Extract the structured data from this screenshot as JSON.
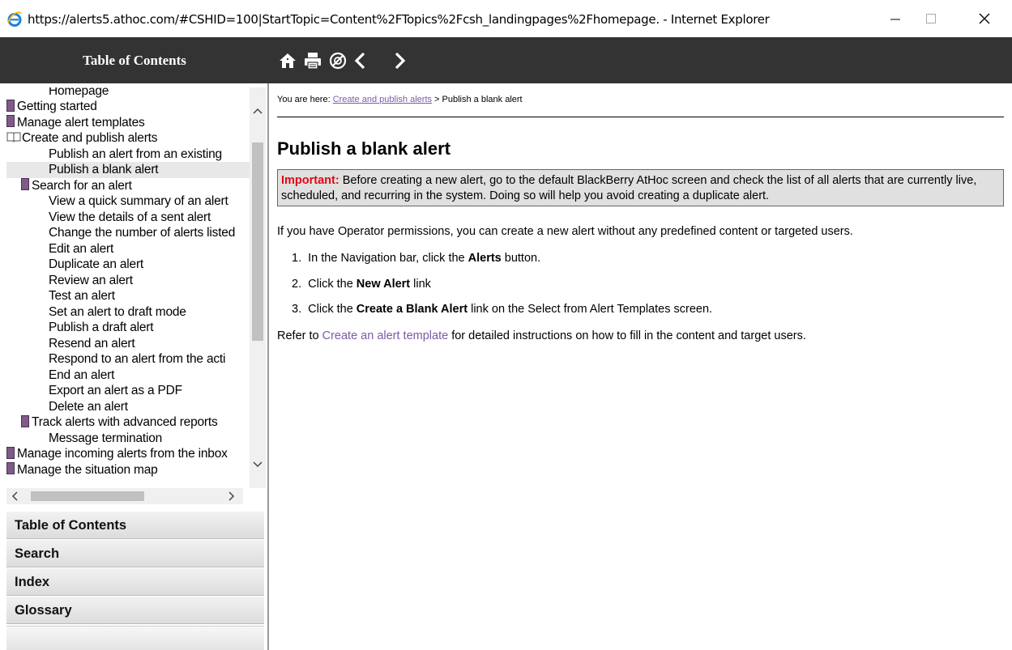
{
  "window": {
    "title": "https://alerts5.athoc.com/#CSHID=100|StartTopic=Content%2FTopics%2Fcsh_landingpages%2Fhomepage. - Internet Explorer"
  },
  "toolbar": {
    "toc_title": "Table of Contents",
    "icons": [
      "home-icon",
      "print-icon",
      "remove-highlight-icon",
      "back-icon",
      "forward-icon"
    ]
  },
  "toc": {
    "items": [
      {
        "label": "Homepage",
        "level": 2,
        "icon": "none"
      },
      {
        "label": "Getting started",
        "level": 0,
        "icon": "book"
      },
      {
        "label": "Manage alert templates",
        "level": 0,
        "icon": "book"
      },
      {
        "label": "Create and publish alerts",
        "level": 0,
        "icon": "open-book"
      },
      {
        "label": "Publish an alert from an existing",
        "level": 2,
        "icon": "none"
      },
      {
        "label": "Publish a blank alert",
        "level": 2,
        "icon": "none",
        "selected": true
      },
      {
        "label": "Search for an alert",
        "level": 1,
        "icon": "book"
      },
      {
        "label": "View a quick summary of an alert",
        "level": 2,
        "icon": "none"
      },
      {
        "label": "View the details of a sent alert",
        "level": 2,
        "icon": "none"
      },
      {
        "label": "Change the number of alerts listed",
        "level": 2,
        "icon": "none"
      },
      {
        "label": "Edit an alert",
        "level": 2,
        "icon": "none"
      },
      {
        "label": "Duplicate an alert",
        "level": 2,
        "icon": "none"
      },
      {
        "label": "Review an alert",
        "level": 2,
        "icon": "none"
      },
      {
        "label": "Test an alert",
        "level": 2,
        "icon": "none"
      },
      {
        "label": "Set an alert to draft mode",
        "level": 2,
        "icon": "none"
      },
      {
        "label": "Publish a draft alert",
        "level": 2,
        "icon": "none"
      },
      {
        "label": "Resend an alert",
        "level": 2,
        "icon": "none"
      },
      {
        "label": "Respond to an alert from the acti",
        "level": 2,
        "icon": "none"
      },
      {
        "label": "End an alert",
        "level": 2,
        "icon": "none"
      },
      {
        "label": "Export an alert as a PDF",
        "level": 2,
        "icon": "none"
      },
      {
        "label": "Delete an alert",
        "level": 2,
        "icon": "none"
      },
      {
        "label": "Track alerts with advanced reports",
        "level": 1,
        "icon": "book"
      },
      {
        "label": "Message termination",
        "level": 2,
        "icon": "none"
      },
      {
        "label": "Manage incoming alerts from the inbox",
        "level": 0,
        "icon": "book"
      },
      {
        "label": "Manage the situation map",
        "level": 0,
        "icon": "book"
      }
    ]
  },
  "accordion": {
    "toc": "Table of Contents",
    "search": "Search",
    "index": "Index",
    "glossary": "Glossary"
  },
  "content": {
    "breadcrumb_prefix": "You are here: ",
    "breadcrumb_link": "Create and publish alerts",
    "breadcrumb_current": " > Publish a blank alert",
    "title": "Publish a blank alert",
    "important_label": "Important:",
    "important_text": " Before creating a new alert, go to the default BlackBerry AtHoc screen and check the list of all alerts that are currently live, scheduled, and recurring in the system. Doing so will help you avoid creating a duplicate alert.",
    "intro": "If you have Operator permissions, you can create a new alert without any predefined content or targeted users.",
    "steps": [
      {
        "num": "1.",
        "before": "In the Navigation bar, click the ",
        "bold": "Alerts",
        "after": " button."
      },
      {
        "num": "2.",
        "before": "Click the ",
        "bold": "New Alert",
        "after": " link"
      },
      {
        "num": "3.",
        "before": "Click the ",
        "bold": "Create a Blank Alert",
        "after": " link on the Select from Alert Templates screen."
      }
    ],
    "refer_before": "Refer to ",
    "refer_link": "Create an alert template",
    "refer_after": " for detailed instructions on how to fill in the content and target users."
  }
}
